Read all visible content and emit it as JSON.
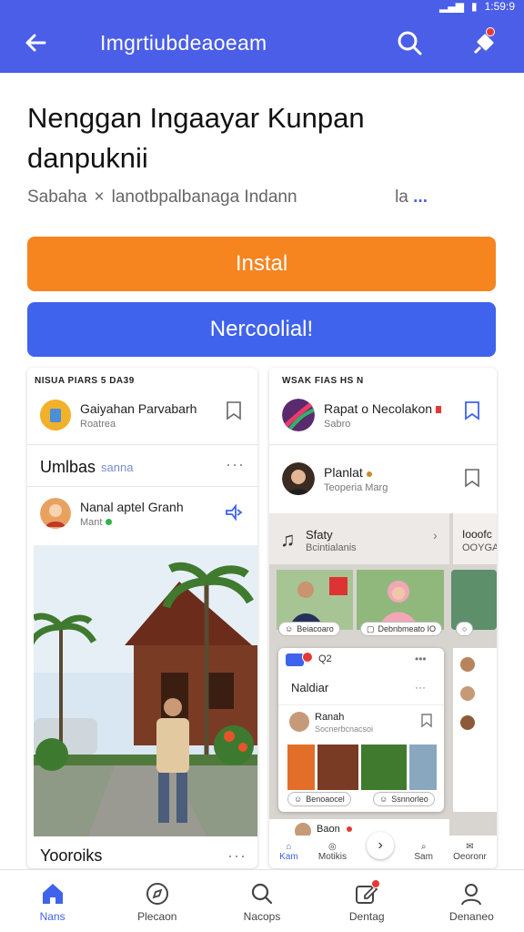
{
  "status": {
    "time": "1:59:9"
  },
  "appbar": {
    "title": "Imgrtiubdeaoeam",
    "back_icon": "arrow-left-icon",
    "search_icon": "search-icon",
    "pin_icon": "pin-icon"
  },
  "heading": {
    "line1": "Nenggan Ingaayar Kunpan",
    "line2": "danpuknii"
  },
  "subline": {
    "left": "Sabaha",
    "sep": "×",
    "right": "lanotbpalbanaga Indann",
    "more": "la",
    "more_dots": "..."
  },
  "buttons": {
    "install": "Instal",
    "secondary": "Nercoolial!"
  },
  "left_card": {
    "caption": "NISUA PIARS 5 DA39",
    "item1": {
      "title": "Gaiyahan Parvabarh",
      "sub": "Roatrea"
    },
    "section": {
      "title": "Umlbas",
      "tag": "sanna",
      "more": "···"
    },
    "item2": {
      "title": "Nanal aptel Granh",
      "sub": "Mant"
    },
    "footer": {
      "title": "Yooroiks",
      "more": "···"
    }
  },
  "right_card": {
    "caption": "WSAK FIAS HS N",
    "item1": {
      "title": "Rapat o Necolakon",
      "sub": "Sabro"
    },
    "item2": {
      "title": "Planlat",
      "sub": "Teoperia Marg"
    },
    "story": {
      "title": "Sfaty",
      "sub": "Bcintialanis",
      "side_title": "Iooofc",
      "side_sub": "OOYGA"
    },
    "chip_left": "Beiacoaro",
    "chip_right": "Debnbmeato IO",
    "popup": {
      "tab": "Q2",
      "title": "Naldiar",
      "item_title": "Ranah",
      "item_sub": "Socnerbcnacsoi",
      "chip_left": "Benoaocel",
      "chip_right": "Ssnnorleo"
    },
    "post": {
      "title": "Baon"
    },
    "mini_nav": [
      "Kam",
      "Motikis",
      "Sam",
      "Oeoronr"
    ]
  },
  "bottom_nav": [
    {
      "label": "Nans",
      "icon": "home-icon",
      "active": true
    },
    {
      "label": "Plecaon",
      "icon": "compass-icon",
      "active": false
    },
    {
      "label": "Nacops",
      "icon": "search-icon",
      "active": false
    },
    {
      "label": "Dentag",
      "icon": "edit-icon",
      "active": false
    },
    {
      "label": "Denaneo",
      "icon": "person-icon",
      "active": false
    }
  ],
  "colors": {
    "primary": "#4a5ee8",
    "install": "#f6841f",
    "secondary_btn": "#3f63ec",
    "badge": "#e53935"
  }
}
